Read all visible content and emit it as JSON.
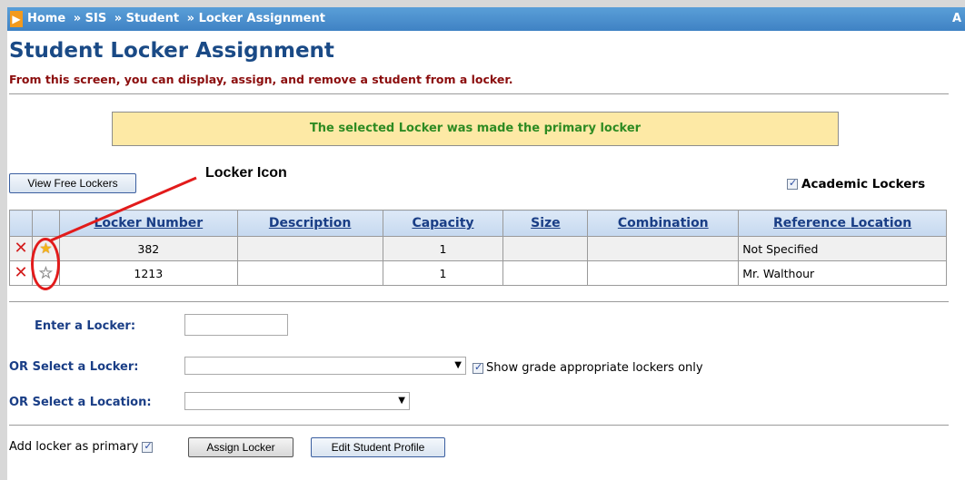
{
  "breadcrumb": {
    "items": [
      "Home",
      "» SIS",
      "» Student",
      "» Locker Assignment"
    ],
    "right_text": "A"
  },
  "page": {
    "title": "Student Locker Assignment",
    "subtitle": "From this screen, you can display, assign, and remove a student from a locker.",
    "message": "The selected Locker was made the primary locker"
  },
  "toolbar": {
    "view_free_lockers": "View Free Lockers",
    "academic_lockers_label": "Academic Lockers",
    "academic_lockers_checked": true
  },
  "annotation": {
    "label": "Locker Icon",
    "color": "#e21b1b"
  },
  "table": {
    "columns": [
      "Locker Number",
      "Description",
      "Capacity",
      "Size",
      "Combination",
      "Reference Location"
    ],
    "rows": [
      {
        "delete_icon": "delete-x-icon",
        "star_icon": "primary-star-icon",
        "locker_number": "382",
        "description": "",
        "capacity": "1",
        "size": "",
        "combination": "",
        "reference_location": "Not Specified"
      },
      {
        "delete_icon": "delete-x-icon",
        "star_icon": "non-primary-star-icon",
        "locker_number": "1213",
        "description": "",
        "capacity": "1",
        "size": "",
        "combination": "",
        "reference_location": "Mr. Walthour"
      }
    ]
  },
  "form": {
    "enter_locker_label": "Enter a Locker:",
    "enter_locker_value": "",
    "select_locker_label": "OR Select a Locker:",
    "select_locker_value": "",
    "grade_appropriate_label": "Show grade appropriate lockers only",
    "grade_appropriate_checked": true,
    "select_location_label": "OR Select a Location:",
    "select_location_value": "",
    "add_primary_label": "Add locker as primary",
    "add_primary_checked": true,
    "assign_locker_button": "Assign Locker",
    "edit_profile_button": "Edit Student Profile"
  },
  "colors": {
    "topbar": "#3f82c4",
    "title": "#1a4a86",
    "subtitle": "#8b0d0d",
    "message_bg": "#fde9a5",
    "message_text": "#2e8b22",
    "delete_icon": "#d31c1c",
    "primary_star": "#f3b418"
  }
}
